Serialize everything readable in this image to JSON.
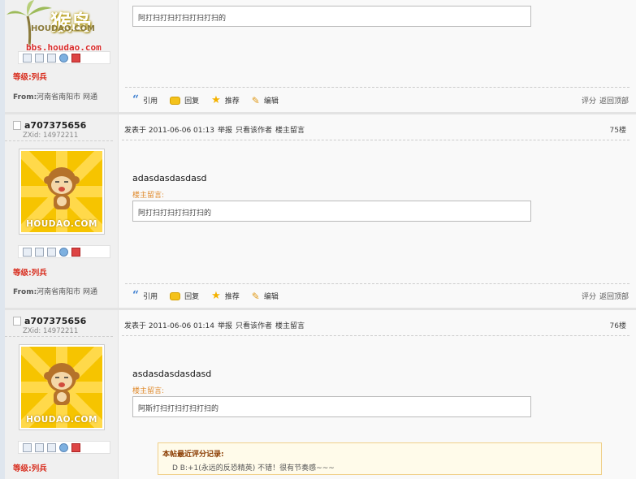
{
  "top_post": {
    "note_text": "阿打扫打扫打扫打扫打扫的",
    "rank": "等级:列兵",
    "from_label": "From:",
    "from_value": "河南省南阳市 网通"
  },
  "posts": [
    {
      "username": "a707375656",
      "zxid": "ZXid: 14972211",
      "meta_prefix": "发表于 2011-06-06 01:13",
      "meta_report": "举报",
      "meta_author_only": "只看该作者",
      "meta_owner_note": "楼主留言",
      "floor": "75楼",
      "body": "adasdasdasdasd",
      "note_label": "楼主留言:",
      "note_text": "阿打扫打扫打扫打扫的",
      "rank": "等级:列兵",
      "from_label": "From:",
      "from_value": "河南省南阳市 网通",
      "avatar_mark": "HOUDAO.COM"
    },
    {
      "username": "a707375656",
      "zxid": "ZXid: 14972211",
      "meta_prefix": "发表于 2011-06-06 01:14",
      "meta_report": "举报",
      "meta_author_only": "只看该作者",
      "meta_owner_note": "楼主留言",
      "floor": "76楼",
      "body": "asdasdasdasdasd",
      "note_label": "楼主留言:",
      "note_text": "阿斯打扫打扫打扫打扫的",
      "rank": "等级:列兵",
      "avatar_mark": "HOUDAO.COM"
    }
  ],
  "toolbar": {
    "quote": "引用",
    "reply": "回复",
    "recommend": "推荐",
    "edit": "编辑",
    "rate": "评分",
    "top": "返回顶部"
  },
  "rating": {
    "title": "本帖最近评分记录:",
    "entry": "D B:+1(永远的反恐精英) 不错！很有节奏感~~~"
  },
  "logo": {
    "cn": "猴岛",
    "en": "HOUDAO.COM",
    "url": "bbs.houdao.com"
  },
  "colors": {
    "rank": "#d82d1e",
    "note_label": "#e08a2c",
    "avatar_bg": "#f6c400"
  }
}
